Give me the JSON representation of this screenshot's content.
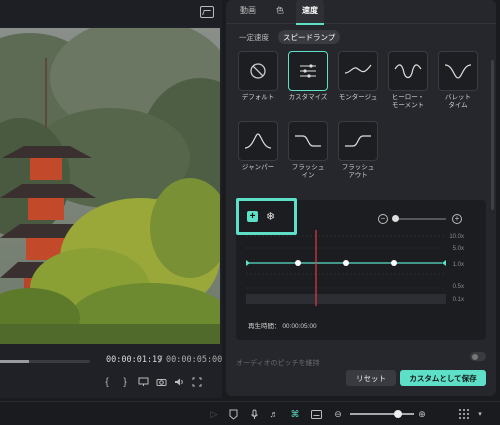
{
  "preview": {
    "current_time": "00:00:01:19",
    "separator": "/",
    "total_time": "00:00:05:00",
    "progress_fraction": 0.32,
    "controls": [
      "mark-in-icon",
      "mark-out-icon",
      "monitor-icon",
      "camera-icon",
      "volume-icon",
      "fullscreen-icon"
    ]
  },
  "panel": {
    "tabs": [
      {
        "label": "動画"
      },
      {
        "label": "色"
      },
      {
        "label": "速度",
        "active": true
      }
    ],
    "subtabs": [
      {
        "label": "一定速度"
      },
      {
        "label": "スピードランプ",
        "active": true
      }
    ],
    "presets": [
      {
        "label": "デフォルト",
        "icon": "no-ramp-icon"
      },
      {
        "label": "カスタマイズ",
        "icon": "sliders-icon",
        "selected": true
      },
      {
        "label": "モンタージュ",
        "icon": "montage-curve-icon"
      },
      {
        "label": "ヒーロー・\nモーメント",
        "icon": "hero-moment-curve-icon"
      },
      {
        "label": "バレット\nタイム",
        "icon": "bullet-time-curve-icon"
      },
      {
        "label": "ジャンパー",
        "icon": "jumper-curve-icon"
      },
      {
        "label": "フラッシュ\nイン",
        "icon": "flash-in-curve-icon"
      },
      {
        "label": "フラッシュ\nアウト",
        "icon": "flash-out-curve-icon"
      }
    ],
    "graph": {
      "y_ticks": [
        "10.0x",
        "5.0x",
        "1.0x",
        "0.5x",
        "0.1x"
      ],
      "keyframe_count": 3,
      "playback_label": "再生時間：",
      "playback_time": "00:00:05:00"
    },
    "audio_pitch_label": "オーディオのピッチを維持",
    "reset_label": "リセット",
    "save_label": "カスタムとして保存",
    "accent_color": "#5de0c7"
  }
}
